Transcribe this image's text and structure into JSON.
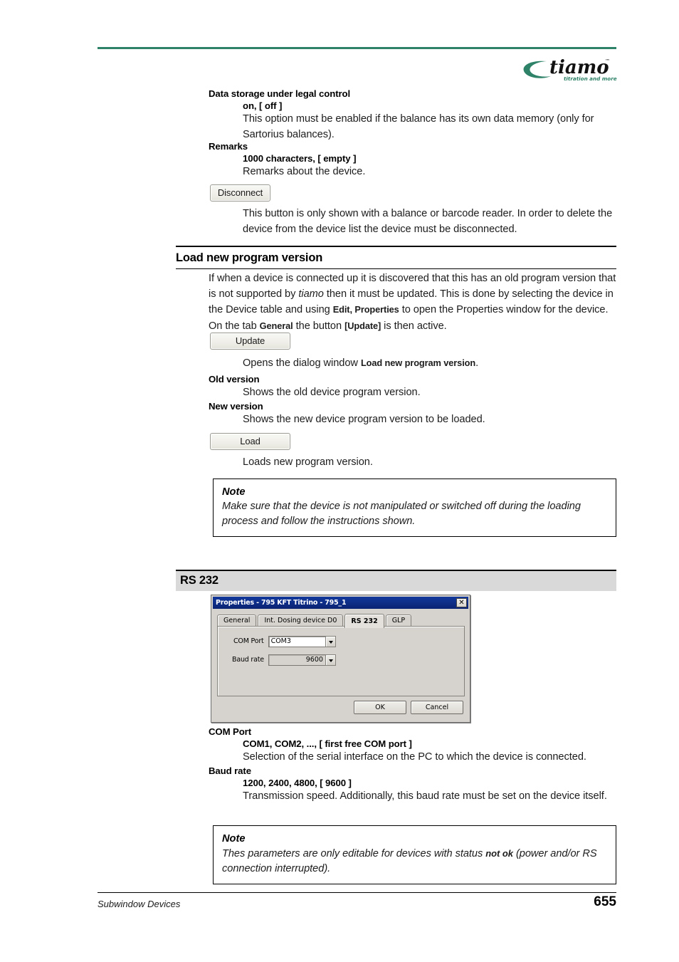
{
  "header": {
    "logo_name": "tiamo",
    "logo_tagline": "titration and more",
    "logo_tm": "™",
    "accent_color": "#2e8268"
  },
  "entries_top": [
    {
      "term": "Data storage under legal control",
      "values": "on, [ off ]",
      "desc": "This option must be enabled if the balance has its own data memory (only for Sartorius balances)."
    },
    {
      "term": "Remarks",
      "values": "1000 characters, [ empty ]",
      "desc": "Remarks about the device."
    }
  ],
  "disconnect": {
    "button_label": "Disconnect",
    "desc": "This button is only shown with a balance or barcode reader. In order to delete the device from the device list the device must be disconnected."
  },
  "section_load": {
    "heading": "Load new program version",
    "intro_part1": "If when a device is connected up it is discovered that this has an old program version that is not supported by ",
    "intro_italic": "tiamo",
    "intro_part2": " then it must be updated. This is done by selecting the device in the Device table and using ",
    "intro_bold1": "Edit, Properties",
    "intro_part3": " to open the Properties window for the device. On the tab ",
    "intro_bold2": "General",
    "intro_part4": " the button ",
    "intro_bold3": "[Update]",
    "intro_part5": " is then active.",
    "update_button": "Update",
    "update_desc_pre": "Opens the dialog window ",
    "update_desc_bold": "Load new program version",
    "update_desc_post": ".",
    "old_version_term": "Old version",
    "old_version_desc": "Shows the old device program version.",
    "new_version_term": "New version",
    "new_version_desc": "Shows the new device program version to be loaded.",
    "load_button": "Load",
    "load_desc": "Loads new program version."
  },
  "note_top": {
    "title": "Note",
    "body": "Make sure that the device is not manipulated or switched off during the loading process and follow the instructions shown."
  },
  "section_rs232": {
    "heading": "RS 232"
  },
  "dialog": {
    "title": "Properties - 795 KFT Titrino - 795_1",
    "close_label": "✕",
    "tabs": [
      {
        "label": "General",
        "active": false
      },
      {
        "label": "Int. Dosing device D0",
        "active": false
      },
      {
        "label": "RS 232",
        "active": true
      },
      {
        "label": "GLP",
        "active": false
      }
    ],
    "fields": [
      {
        "label": "COM Port",
        "value": "COM3"
      },
      {
        "label": "Baud rate",
        "value": "9600"
      }
    ],
    "ok_label": "OK",
    "cancel_label": "Cancel"
  },
  "entries_bottom": [
    {
      "term": "COM Port",
      "values": "COM1, COM2, ..., [ first free COM port ]",
      "desc": "Selection of the serial interface on the PC to which the device is connected."
    },
    {
      "term": "Baud rate",
      "values": "1200, 2400, 4800, [ 9600 ]",
      "desc": "Transmission speed. Additionally, this baud rate must be set on the device itself."
    }
  ],
  "note_bottom": {
    "title": "Note",
    "body_pre": "Thes parameters are only editable for devices with status ",
    "body_bold": "not ok",
    "body_post": " (power and/or RS connection interrupted)."
  },
  "footer": {
    "left": "Subwindow Devices",
    "page": "655"
  }
}
